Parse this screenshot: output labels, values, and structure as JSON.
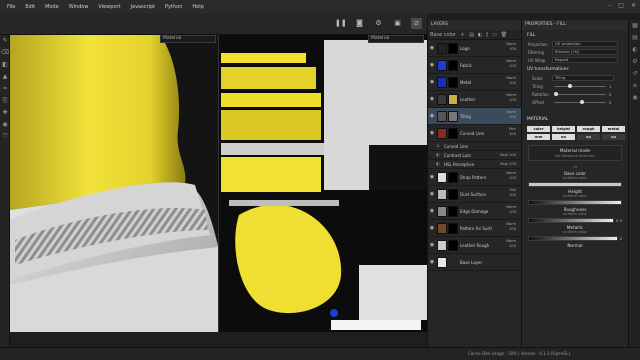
{
  "menu": [
    "File",
    "Edit",
    "Mode",
    "Window",
    "Viewport",
    "Javascript",
    "Python",
    "Help"
  ],
  "viewport3d": {
    "view_select": "Material"
  },
  "viewport2d": {
    "view_select": "Material"
  },
  "layers_panel": {
    "title": "LAYERS",
    "channel_select": "Base color",
    "layers": [
      {
        "name": "Logo",
        "blend": "Norm",
        "opacity": "100",
        "thumb": "#222",
        "mask": "#000"
      },
      {
        "name": "Fabric",
        "blend": "Norm",
        "opacity": "100",
        "thumb": "#1e3bd6",
        "mask": "#000"
      },
      {
        "name": "Metal",
        "blend": "Norm",
        "opacity": "100",
        "thumb": "#1c2fb0",
        "mask": "#000"
      },
      {
        "name": "Leather",
        "blend": "Norm",
        "opacity": "100",
        "thumb": "#3a3a3a",
        "mask": "#c9b04a"
      },
      {
        "name": "Tiling",
        "blend": "Norm",
        "opacity": "100",
        "thumb": "#555",
        "mask": "#777",
        "selected": true
      },
      {
        "name": "Curved Line",
        "blend": "Pthr",
        "opacity": "100",
        "thumb": "#8a2a1a",
        "mask": "#000"
      }
    ],
    "effects": [
      {
        "name": "Curved Line",
        "blend": "",
        "opacity": ""
      },
      {
        "name": "Contrast Lum",
        "blend": "Repl",
        "opacity": "100"
      },
      {
        "name": "HSL Perceptive",
        "blend": "Repl",
        "opacity": "100"
      }
    ],
    "layers2": [
      {
        "name": "Strap Pattern",
        "blend": "Norm",
        "opacity": "100",
        "thumb": "#ddd",
        "mask": "#000"
      },
      {
        "name": "Dust Surface",
        "blend": "Mul",
        "opacity": "100",
        "thumb": "#bbb",
        "mask": "#000"
      },
      {
        "name": "Edge Damage",
        "blend": "Norm",
        "opacity": "100",
        "thumb": "#888",
        "mask": "#000"
      },
      {
        "name": "Pattern for Surface",
        "blend": "Norm",
        "opacity": "100",
        "thumb": "#6d4b2a",
        "mask": "#000"
      },
      {
        "name": "Leather Rough",
        "blend": "Norm",
        "opacity": "100",
        "thumb": "#ccc",
        "mask": "#000"
      },
      {
        "name": "Base Layer",
        "blend": "",
        "opacity": "",
        "thumb": "#e6e6e6",
        "mask": "#000"
      }
    ]
  },
  "properties_panel": {
    "title": "PROPERTIES - FILL",
    "fill_section": "FILL",
    "projection_label": "Projection",
    "projection_value": "UV projection",
    "filtering_label": "Filtering",
    "filtering_value": "Bilinear | HQ",
    "uvwrap_label": "UV Wrap",
    "uvwrap_value": "Repeat",
    "uv_transform_section": "UV transformations",
    "scale_label": "Scale",
    "scale_value": "Tiling",
    "tiling_label": "Tiling",
    "tiling_value": "1",
    "rotation_label": "Rotation",
    "rotation_value": "0",
    "offset_label": "Offset",
    "offset_value": "0",
    "material_section": "MATERIAL",
    "channels": [
      "color",
      "height",
      "rough",
      "metal",
      "nrm",
      "ao",
      "op",
      "op"
    ],
    "channels_off": [
      false,
      false,
      false,
      false,
      false,
      false,
      true,
      true
    ],
    "material_mode_title": "Material mode",
    "material_mode_value": "No Resource Selected",
    "or_text": "Or",
    "base_color_title": "Base color",
    "base_color_sub": "uniform color",
    "height_title": "Height",
    "height_sub": "uniform color",
    "roughness_title": "Roughness",
    "roughness_sub": "uniform color",
    "roughness_value": "0.3",
    "metallic_title": "Metallic",
    "metallic_sub": "uniform color",
    "metallic_value": "0",
    "normal_title": "Normal"
  },
  "statusbar": {
    "text": "Cache Disk Usage : 30% | Version : 6.1.3 (OpenGL)"
  },
  "colors": {
    "accent_yellow": "#f0e030",
    "panel_bg": "#262626",
    "select_blue": "#3b4a5c"
  }
}
